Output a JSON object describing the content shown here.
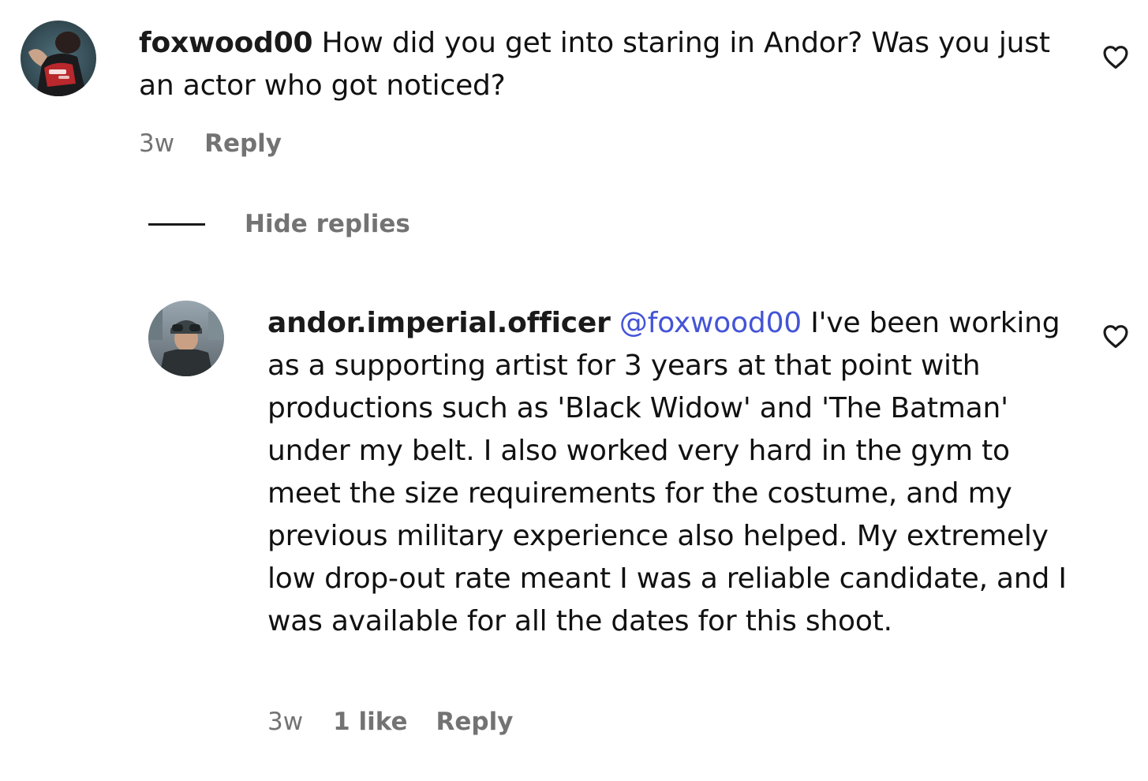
{
  "comments": [
    {
      "username": "foxwood00",
      "text": "How did you get into staring in Andor? Was you just an actor who got noticed?",
      "time": "3w",
      "reply_label": "Reply",
      "like_icon": "heart-outline-icon"
    }
  ],
  "replies_toggle": {
    "label": "Hide replies"
  },
  "replies": [
    {
      "username": "andor.imperial.officer",
      "mention": "@foxwood00",
      "text": "I've been working as a supporting artist for 3 years at that point with productions such as 'Black Widow' and 'The Batman' under my belt. I also worked very hard in the gym to meet the size requirements for the costume, and my previous military experience also helped. My extremely low drop-out rate meant I was a reliable candidate, and I was available for all the dates for this shoot.",
      "time": "3w",
      "likes": "1 like",
      "reply_label": "Reply",
      "like_icon": "heart-outline-icon"
    }
  ],
  "colors": {
    "mention": "#4454d6",
    "meta": "#737373",
    "text": "#111111"
  }
}
